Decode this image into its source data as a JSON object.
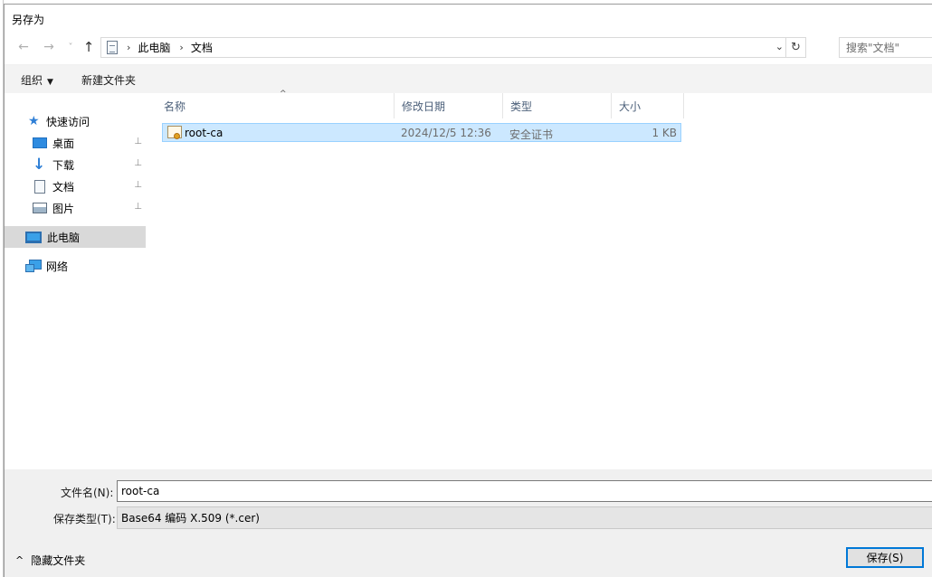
{
  "window": {
    "title": "另存为"
  },
  "nav": {
    "back": "←",
    "forward": "→",
    "recent": "˅",
    "up": "↑"
  },
  "address": {
    "crumbs": [
      "此电脑",
      "文档"
    ],
    "separator": "›",
    "dropdown": "⌄",
    "refresh": "↻"
  },
  "search": {
    "placeholder": "搜索\"文档\""
  },
  "toolbar": {
    "organize": "组织",
    "organize_caret": "▼",
    "new_folder": "新建文件夹"
  },
  "sidebar": {
    "items": [
      {
        "label": "快速访问",
        "icon": "star-icon",
        "pinned": false
      },
      {
        "label": "桌面",
        "icon": "desktop-icon",
        "pinned": true
      },
      {
        "label": "下载",
        "icon": "download-icon",
        "pinned": true
      },
      {
        "label": "文档",
        "icon": "document-icon",
        "pinned": true
      },
      {
        "label": "图片",
        "icon": "pictures-icon",
        "pinned": true
      },
      {
        "label": "此电脑",
        "icon": "computer-icon",
        "pinned": false,
        "selected": true
      },
      {
        "label": "网络",
        "icon": "network-icon",
        "pinned": false
      }
    ],
    "pin_glyph": "📌"
  },
  "filelist": {
    "columns": [
      "名称",
      "修改日期",
      "类型",
      "大小"
    ],
    "sort_indicator": "^",
    "rows": [
      {
        "name": "root-ca",
        "modified": "2024/12/5 12:36",
        "type": "安全证书",
        "size": "1 KB",
        "icon": "certificate-icon",
        "selected": true
      }
    ]
  },
  "footer": {
    "filename_label": "文件名(N):",
    "filename_value": "root-ca",
    "filetype_label": "保存类型(T):",
    "filetype_value": "Base64 编码 X.509 (*.cer)",
    "hide_folders": "隐藏文件夹",
    "hide_folders_chevron": "^",
    "save_button": "保存(S)"
  },
  "colors": {
    "accent": "#0078d7",
    "selection": "#cce8ff",
    "selection_border": "#99d1ff"
  }
}
